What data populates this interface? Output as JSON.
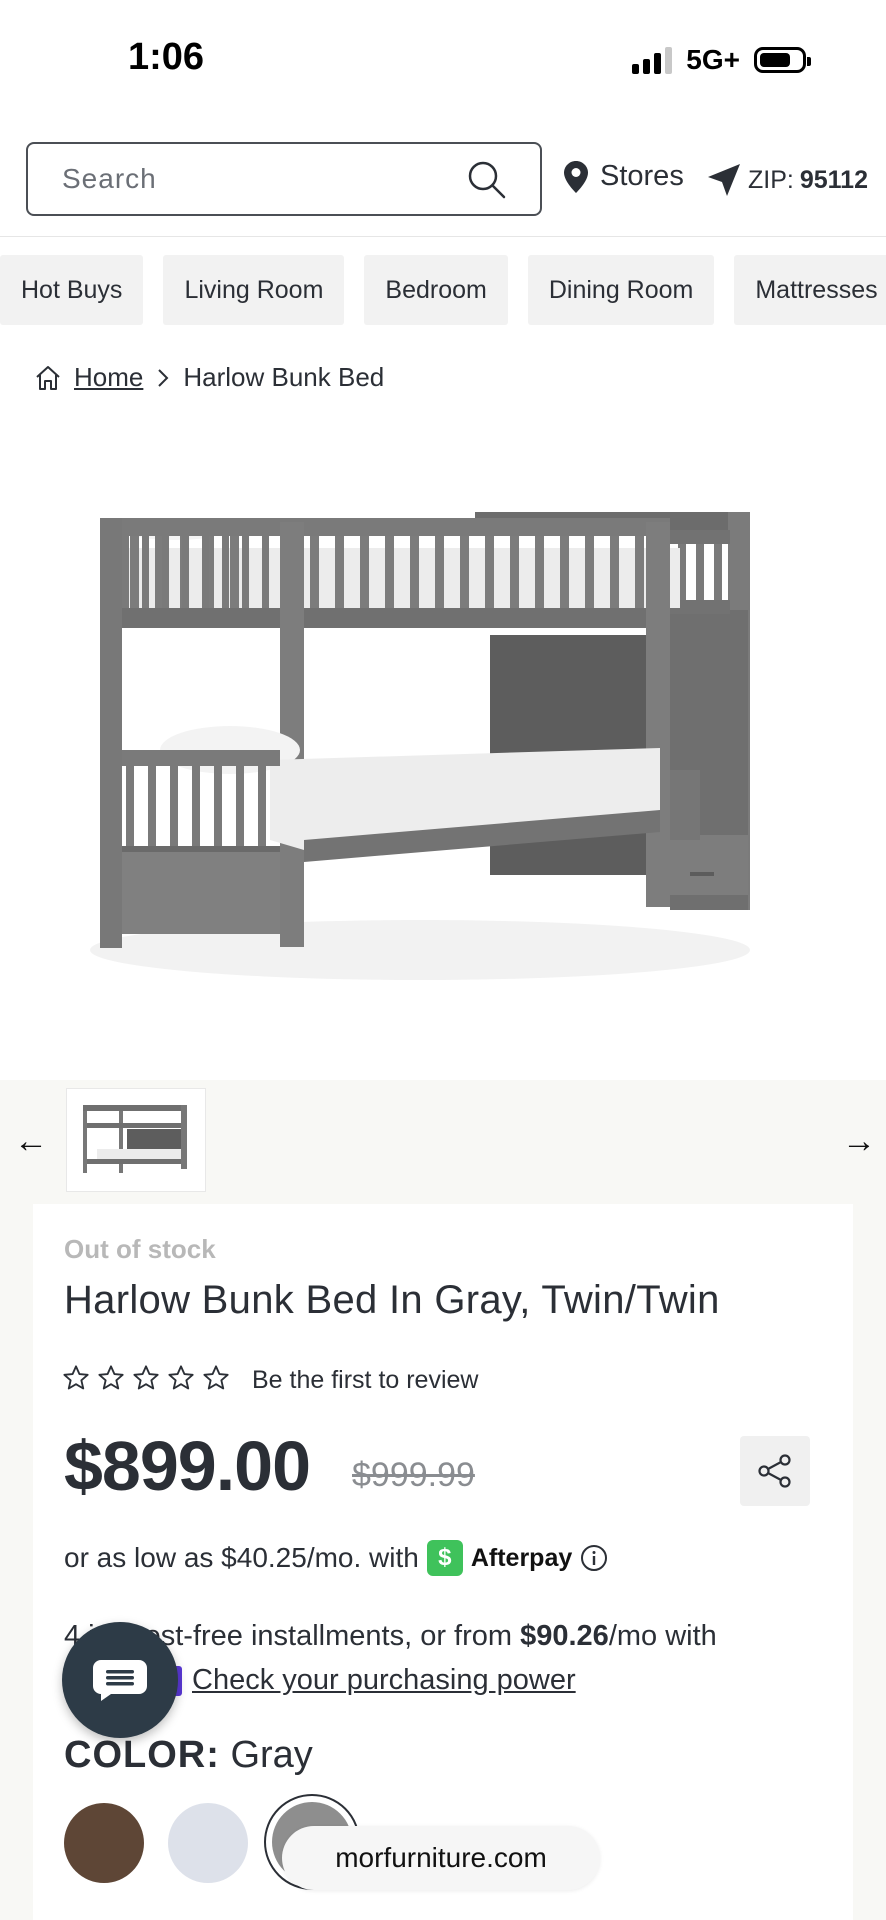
{
  "status_bar": {
    "time": "1:06",
    "network": "5G+"
  },
  "search": {
    "placeholder": "Search"
  },
  "header": {
    "stores_label": "Stores",
    "zip_label": "ZIP:",
    "zip_value": "95112"
  },
  "categories": [
    "Hot Buys",
    "Living Room",
    "Bedroom",
    "Dining Room",
    "Mattresses"
  ],
  "breadcrumb": {
    "home": "Home",
    "current": "Harlow Bunk Bed"
  },
  "product": {
    "stock_status": "Out of stock",
    "title": "Harlow Bunk Bed In Gray, Twin/Twin",
    "rating_stars": 0,
    "review_cta": "Be the first to review",
    "price": "$899.00",
    "original_price": "$999.99",
    "afterpay_text": "or as low as $40.25/mo. with",
    "afterpay_name": "Afterpay",
    "installments_text_a": "4 interest-free installments, or from",
    "installments_amount": "$90.26",
    "installments_text_b": "/mo with",
    "purchasing_power_link": "Check your purchasing power",
    "color_label": "COLOR:",
    "color_value": "Gray",
    "swatches": [
      {
        "name": "brown",
        "color": "#5e4636"
      },
      {
        "name": "white",
        "color": "#dde1ea"
      },
      {
        "name": "gray",
        "color": "#8e8e8e"
      }
    ]
  },
  "browser": {
    "url": "morfurniture.com"
  },
  "colors": {
    "text": "#2b2f36",
    "afterpay_green": "#3fc25b",
    "chat_bg": "#2d3b47"
  }
}
